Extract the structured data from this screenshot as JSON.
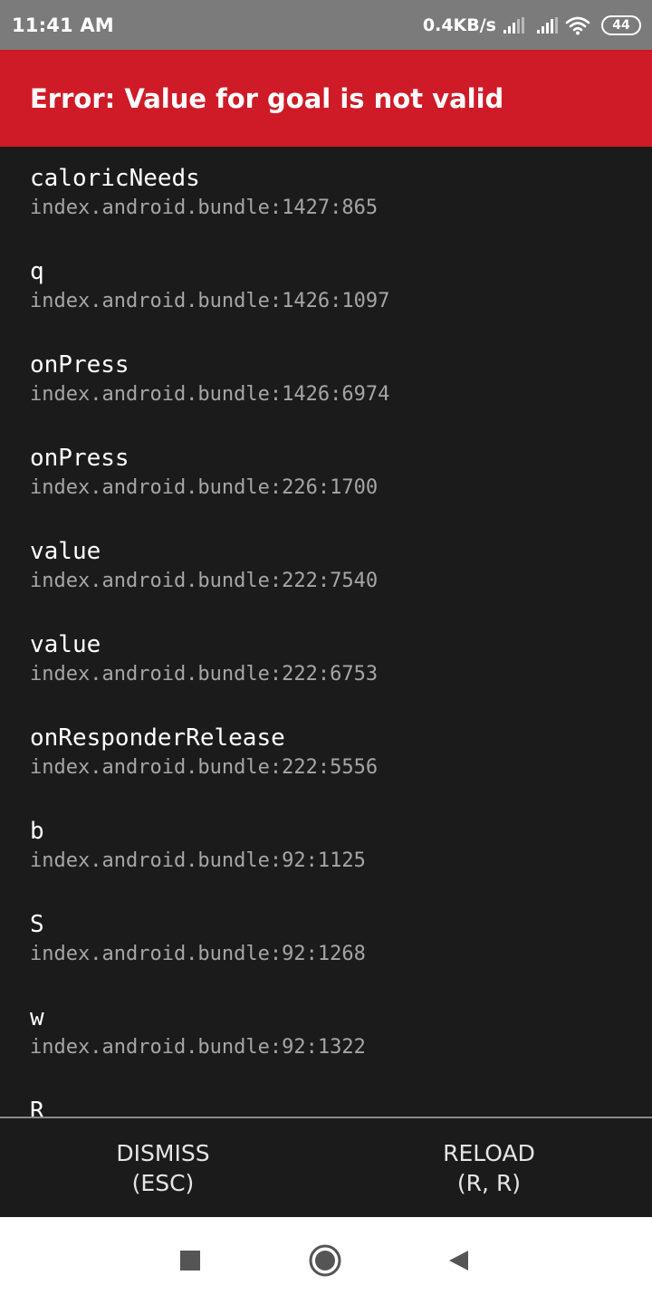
{
  "status_bar": {
    "time": "11:41 AM",
    "net_speed": "0.4KB/s",
    "battery": "44",
    "icons": [
      "signal-icon",
      "signal-icon",
      "wifi-icon",
      "battery-icon"
    ]
  },
  "error": {
    "title": "Error: Value for goal is not valid",
    "color": "#cf1b27"
  },
  "stack": [
    {
      "method": "caloricNeeds",
      "location": "index.android.bundle:1427:865"
    },
    {
      "method": "q",
      "location": "index.android.bundle:1426:1097"
    },
    {
      "method": "onPress",
      "location": "index.android.bundle:1426:6974"
    },
    {
      "method": "onPress",
      "location": "index.android.bundle:226:1700"
    },
    {
      "method": "value",
      "location": "index.android.bundle:222:7540"
    },
    {
      "method": "value",
      "location": "index.android.bundle:222:6753"
    },
    {
      "method": "onResponderRelease",
      "location": "index.android.bundle:222:5556"
    },
    {
      "method": "b",
      "location": "index.android.bundle:92:1125"
    },
    {
      "method": "S",
      "location": "index.android.bundle:92:1268"
    },
    {
      "method": "w",
      "location": "index.android.bundle:92:1322"
    },
    {
      "method": "R",
      "location": ""
    }
  ],
  "buttons": {
    "dismiss_label": "DISMISS",
    "dismiss_shortcut": "(ESC)",
    "reload_label": "RELOAD",
    "reload_shortcut": "(R, R)"
  },
  "nav_bar": {
    "icons": [
      "recents-icon",
      "home-icon",
      "back-icon"
    ]
  }
}
